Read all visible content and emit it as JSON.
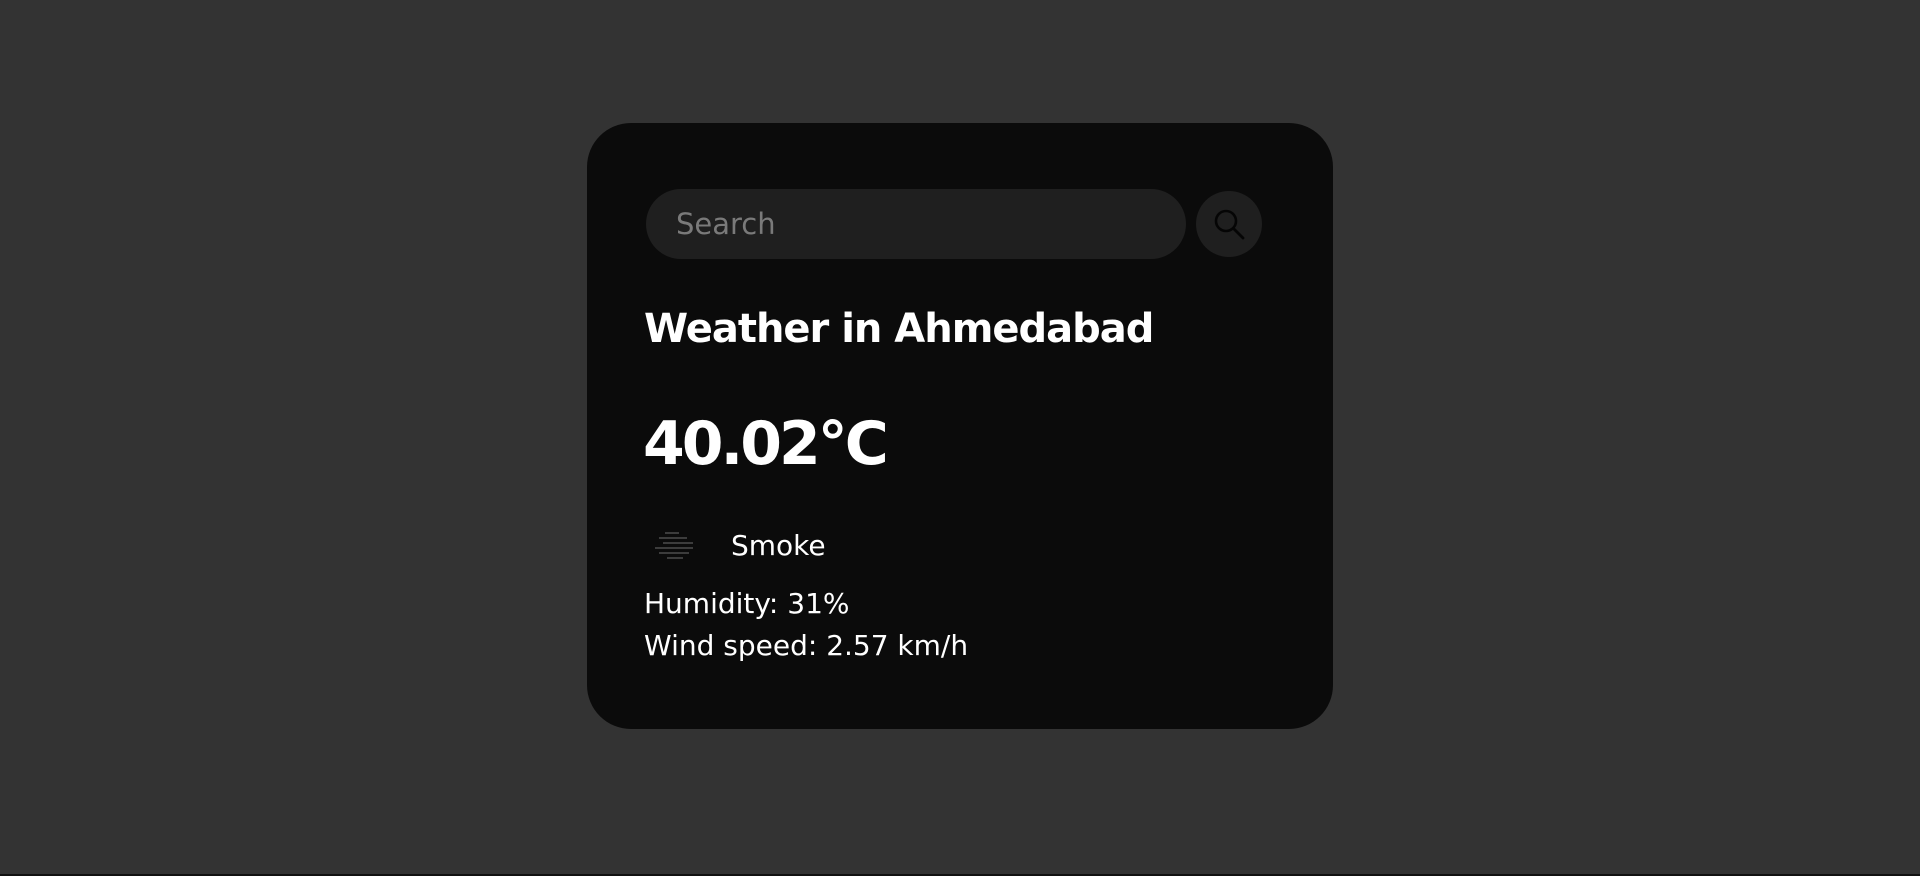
{
  "search": {
    "placeholder": "Search",
    "value": "",
    "button_icon": "search-icon"
  },
  "weather": {
    "title": "Weather in Ahmedabad",
    "temperature": "40.02°C",
    "condition_icon": "smoke-icon",
    "description": "Smoke",
    "humidity": "Humidity: 31%",
    "wind_speed": "Wind speed: 2.57 km/h"
  },
  "colors": {
    "page_background": "#333333",
    "card_background": "#0b0b0b",
    "input_background": "#1f1f1f",
    "text": "#ffffff",
    "placeholder": "#7a7a7a"
  }
}
